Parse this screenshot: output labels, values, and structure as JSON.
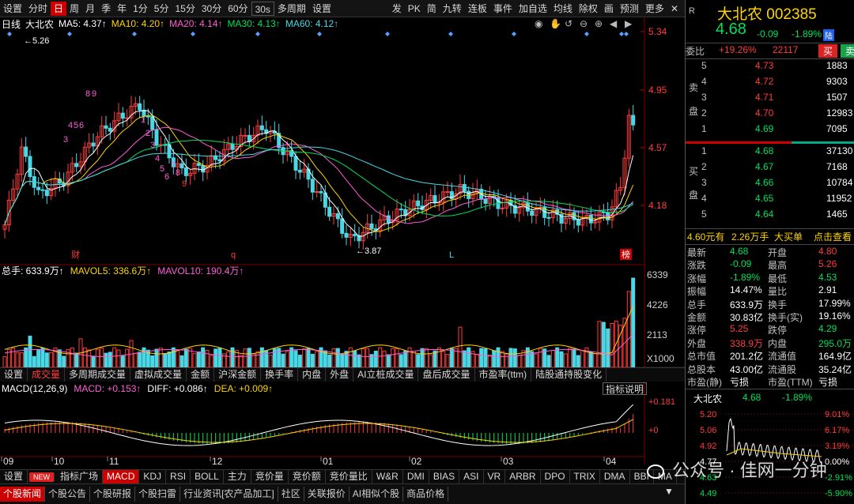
{
  "toolbar": {
    "left": [
      "设置",
      "分时",
      "日",
      "周",
      "月",
      "季",
      "年",
      "1分",
      "5分",
      "15分",
      "30分",
      "60分",
      "30s",
      "多周期",
      "设置"
    ],
    "active_index": 2,
    "right": [
      "发",
      "PK",
      "简",
      "九转",
      "连板",
      "事件",
      "加自选",
      "均线",
      "除权",
      "画",
      "预测",
      "更多"
    ]
  },
  "ma_line": {
    "title": "日线",
    "stock": "大北农",
    "items": [
      {
        "label": "MA5: 4.37↑",
        "color": "#ffffff"
      },
      {
        "label": "MA10: 4.20↑",
        "color": "#ffd400"
      },
      {
        "label": "MA20: 4.14↑",
        "color": "#ff5fd6"
      },
      {
        "label": "MA30: 4.13↑",
        "color": "#00e05a"
      },
      {
        "label": "MA60: 4.12↑",
        "color": "#4ad7e6"
      }
    ]
  },
  "price_axis": [
    "5.34",
    "4.95",
    "4.57",
    "4.18"
  ],
  "price_high_label": "5.26",
  "price_low_label": "3.87",
  "markers": {
    "cai": "财",
    "q": "q",
    "L": "L",
    "bang": "榜"
  },
  "td_numbers": [
    "8",
    "9",
    "4",
    "5",
    "6",
    "3",
    "1",
    "2",
    "3",
    "4",
    "5",
    "6",
    "7",
    "8",
    "9"
  ],
  "vol_line": {
    "items": [
      {
        "label": "总手: 633.9万↑",
        "color": "#ffffff"
      },
      {
        "label": "MAVOL5: 336.6万↑",
        "color": "#ffd400"
      },
      {
        "label": "MAVOL10: 190.4万↑",
        "color": "#ff5fd6"
      }
    ]
  },
  "vol_axis": [
    "6339",
    "4226",
    "2113",
    "X1000"
  ],
  "vol_tabs": [
    "设置",
    "成交量",
    "多周期成交量",
    "虚拟成交量",
    "金额",
    "沪深金额",
    "换手率",
    "内盘",
    "外盘",
    "AI立桩成交量",
    "盘后成交量",
    "市盈率(ttm)",
    "陆股通持股变化"
  ],
  "vol_tabs_active": 1,
  "macd_line": {
    "items": [
      {
        "label": "MACD(12,26,9)",
        "color": "#ffffff"
      },
      {
        "label": "MACD: +0.153↑",
        "color": "#ff5fd6"
      },
      {
        "label": "DIFF: +0.086↑",
        "color": "#ffffff"
      },
      {
        "label": "DEA: +0.009↑",
        "color": "#ffd400"
      }
    ],
    "help": "指标说明"
  },
  "macd_axis": [
    "+0.181",
    "+0"
  ],
  "months": [
    "09",
    "10",
    "11",
    "12",
    "01",
    "02",
    "03",
    "04"
  ],
  "indicator_tabs": [
    "设置",
    "NEW",
    "指标广场",
    "MACD",
    "KDJ",
    "RSI",
    "BOLL",
    "主力",
    "竞价量",
    "竞价额",
    "竞价量比",
    "W&R",
    "DMI",
    "BIAS",
    "ASI",
    "VR",
    "ARBR",
    "DPO",
    "TRIX",
    "DMA",
    "BBI",
    "MA"
  ],
  "indicator_active": 3,
  "bottom_tabs": [
    "个股新闻",
    "个股公告",
    "个股研报",
    "个股扫雷",
    "行业资讯[农产品加工]",
    "社区",
    "关联报价",
    "AI相似个股",
    "商品价格"
  ],
  "bottom_active": 0,
  "quote": {
    "r": "R",
    "name": "大北农",
    "code": "002385",
    "price": "4.68",
    "change": "-0.09",
    "pct": "-1.89%",
    "tag": "陆",
    "weibi_label": "委比",
    "weibi": "+19.26%",
    "weicha": "22117",
    "buy": "买",
    "sell": "卖",
    "asks": [
      {
        "lvl": "5",
        "p": "4.73",
        "v": "1883"
      },
      {
        "lvl": "4",
        "p": "4.72",
        "v": "9303"
      },
      {
        "lvl": "3",
        "p": "4.71",
        "v": "1507"
      },
      {
        "lvl": "2",
        "p": "4.70",
        "v": "12983"
      },
      {
        "lvl": "1",
        "p": "4.69",
        "v": "7095"
      }
    ],
    "bids": [
      {
        "lvl": "1",
        "p": "4.68",
        "v": "37130"
      },
      {
        "lvl": "2",
        "p": "4.67",
        "v": "7168"
      },
      {
        "lvl": "3",
        "p": "4.66",
        "v": "10784"
      },
      {
        "lvl": "4",
        "p": "4.65",
        "v": "11952"
      },
      {
        "lvl": "5",
        "p": "4.64",
        "v": "1465"
      }
    ],
    "sell_side": "卖盘",
    "buy_side": "买盘",
    "big_order": {
      "price": "4.60元有",
      "vol": "2.26万手",
      "type": "大买单",
      "link": "点击查看"
    },
    "stats": [
      [
        "最新",
        "4.68",
        "开盘",
        "4.80"
      ],
      [
        "涨跌",
        "-0.09",
        "最高",
        "5.26"
      ],
      [
        "涨幅",
        "-1.89%",
        "最低",
        "4.53"
      ],
      [
        "振幅",
        "14.47%",
        "量比",
        "2.91"
      ],
      [
        "总手",
        "633.9万",
        "换手",
        "17.99%"
      ],
      [
        "金额",
        "30.83亿",
        "换手(实)",
        "19.16%"
      ],
      [
        "涨停",
        "5.25",
        "跌停",
        "4.29"
      ],
      [
        "外盘",
        "338.9万",
        "内盘",
        "295.0万"
      ],
      [
        "总市值",
        "201.2亿",
        "流通值",
        "164.9亿"
      ],
      [
        "总股本",
        "43.00亿",
        "流通股",
        "35.24亿"
      ],
      [
        "市盈(静)",
        "亏损",
        "市盈(TTM)",
        "亏损"
      ]
    ],
    "mini": {
      "name": "大北农",
      "price": "4.68",
      "pct": "-1.89%",
      "axis_left": [
        "5.20",
        "5.06",
        "4.92",
        "4.77",
        "4.63",
        "4.49"
      ],
      "axis_right": [
        "9.01%",
        "6.17%",
        "3.19%",
        "0.00%",
        "-2.91%",
        "-5.90%"
      ]
    }
  },
  "watermark": "公众号 · 佳网一分钟"
}
